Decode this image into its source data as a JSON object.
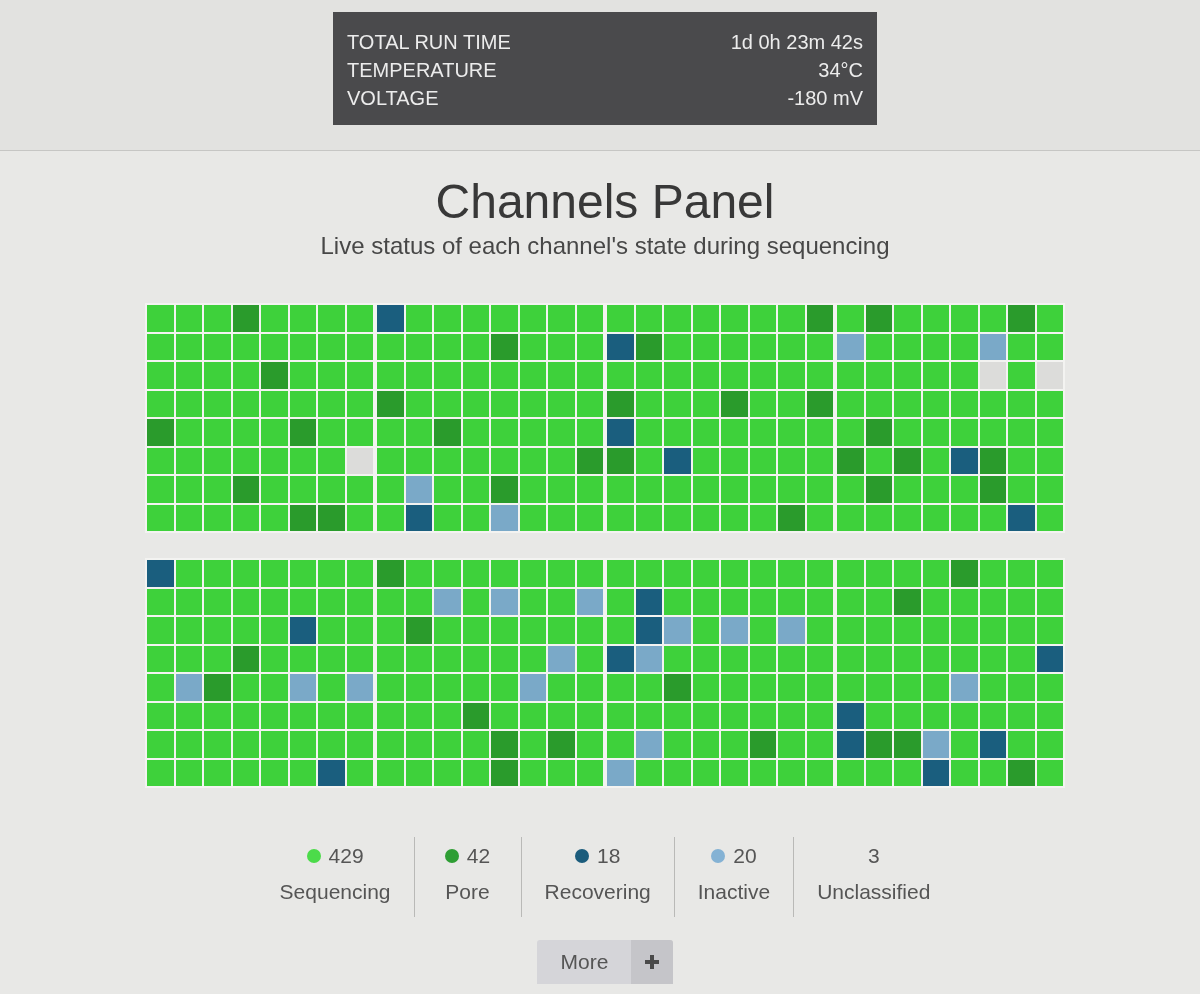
{
  "status_panel": {
    "rows": [
      {
        "label": "TOTAL RUN TIME",
        "value": "1d 0h 23m 42s"
      },
      {
        "label": "TEMPERATURE",
        "value": "34°C"
      },
      {
        "label": "VOLTAGE",
        "value": "-180 mV"
      }
    ]
  },
  "title": "Channels Panel",
  "subtitle": "Live status of each channel's state during sequencing",
  "blocks": [
    {
      "rows": [
        {
          "cells": [
            {
              "color": "#3ed13b"
            },
            {
              "color": "#3ed13b"
            },
            {
              "color": "#3ed13b"
            },
            {
              "color": "#2a9b2c"
            },
            {
              "color": "#3ed13b"
            },
            {
              "color": "#3ed13b"
            },
            {
              "color": "#3ed13b"
            },
            {
              "color": "#3ed13b"
            },
            {
              "color": "#1a5e7e"
            },
            {
              "color": "#3ed13b"
            },
            {
              "color": "#3ed13b"
            },
            {
              "color": "#3ed13b"
            },
            {
              "color": "#3ed13b"
            },
            {
              "color": "#3ed13b"
            },
            {
              "color": "#3ed13b"
            },
            {
              "color": "#3ed13b"
            },
            {
              "color": "#3ed13b"
            },
            {
              "color": "#3ed13b"
            },
            {
              "color": "#3ed13b"
            },
            {
              "color": "#3ed13b"
            },
            {
              "color": "#3ed13b"
            },
            {
              "color": "#3ed13b"
            },
            {
              "color": "#3ed13b"
            },
            {
              "color": "#2a9b2c"
            },
            {
              "color": "#3ed13b"
            },
            {
              "color": "#2a9b2c"
            },
            {
              "color": "#3ed13b"
            },
            {
              "color": "#3ed13b"
            },
            {
              "color": "#3ed13b"
            },
            {
              "color": "#3ed13b"
            },
            {
              "color": "#2a9b2c"
            },
            {
              "color": "#3ed13b"
            }
          ]
        },
        {
          "cells": [
            {
              "color": "#3ed13b"
            },
            {
              "color": "#3ed13b"
            },
            {
              "color": "#3ed13b"
            },
            {
              "color": "#3ed13b"
            },
            {
              "color": "#3ed13b"
            },
            {
              "color": "#3ed13b"
            },
            {
              "color": "#3ed13b"
            },
            {
              "color": "#3ed13b"
            },
            {
              "color": "#3ed13b"
            },
            {
              "color": "#3ed13b"
            },
            {
              "color": "#3ed13b"
            },
            {
              "color": "#3ed13b"
            },
            {
              "color": "#2a9b2c"
            },
            {
              "color": "#3ed13b"
            },
            {
              "color": "#3ed13b"
            },
            {
              "color": "#3ed13b"
            },
            {
              "color": "#1a5e7e"
            },
            {
              "color": "#2a9b2c"
            },
            {
              "color": "#3ed13b"
            },
            {
              "color": "#3ed13b"
            },
            {
              "color": "#3ed13b"
            },
            {
              "color": "#3ed13b"
            },
            {
              "color": "#3ed13b"
            },
            {
              "color": "#3ed13b"
            },
            {
              "color": "#7aa9c8"
            },
            {
              "color": "#3ed13b"
            },
            {
              "color": "#3ed13b"
            },
            {
              "color": "#3ed13b"
            },
            {
              "color": "#3ed13b"
            },
            {
              "color": "#7aa9c8"
            },
            {
              "color": "#3ed13b"
            },
            {
              "color": "#3ed13b"
            }
          ]
        },
        {
          "cells": [
            {
              "color": "#3ed13b"
            },
            {
              "color": "#3ed13b"
            },
            {
              "color": "#3ed13b"
            },
            {
              "color": "#3ed13b"
            },
            {
              "color": "#2a9b2c"
            },
            {
              "color": "#3ed13b"
            },
            {
              "color": "#3ed13b"
            },
            {
              "color": "#3ed13b"
            },
            {
              "color": "#3ed13b"
            },
            {
              "color": "#3ed13b"
            },
            {
              "color": "#3ed13b"
            },
            {
              "color": "#3ed13b"
            },
            {
              "color": "#3ed13b"
            },
            {
              "color": "#3ed13b"
            },
            {
              "color": "#3ed13b"
            },
            {
              "color": "#3ed13b"
            },
            {
              "color": "#3ed13b"
            },
            {
              "color": "#3ed13b"
            },
            {
              "color": "#3ed13b"
            },
            {
              "color": "#3ed13b"
            },
            {
              "color": "#3ed13b"
            },
            {
              "color": "#3ed13b"
            },
            {
              "color": "#3ed13b"
            },
            {
              "color": "#3ed13b"
            },
            {
              "color": "#3ed13b"
            },
            {
              "color": "#3ed13b"
            },
            {
              "color": "#3ed13b"
            },
            {
              "color": "#3ed13b"
            },
            {
              "color": "#3ed13b"
            },
            {
              "color": "#dcdcda"
            },
            {
              "color": "#3ed13b"
            },
            {
              "color": "#dcdcda"
            }
          ]
        },
        {
          "cells": [
            {
              "color": "#3ed13b"
            },
            {
              "color": "#3ed13b"
            },
            {
              "color": "#3ed13b"
            },
            {
              "color": "#3ed13b"
            },
            {
              "color": "#3ed13b"
            },
            {
              "color": "#3ed13b"
            },
            {
              "color": "#3ed13b"
            },
            {
              "color": "#3ed13b"
            },
            {
              "color": "#2a9b2c"
            },
            {
              "color": "#3ed13b"
            },
            {
              "color": "#3ed13b"
            },
            {
              "color": "#3ed13b"
            },
            {
              "color": "#3ed13b"
            },
            {
              "color": "#3ed13b"
            },
            {
              "color": "#3ed13b"
            },
            {
              "color": "#3ed13b"
            },
            {
              "color": "#2a9b2c"
            },
            {
              "color": "#3ed13b"
            },
            {
              "color": "#3ed13b"
            },
            {
              "color": "#3ed13b"
            },
            {
              "color": "#2a9b2c"
            },
            {
              "color": "#3ed13b"
            },
            {
              "color": "#3ed13b"
            },
            {
              "color": "#2a9b2c"
            },
            {
              "color": "#3ed13b"
            },
            {
              "color": "#3ed13b"
            },
            {
              "color": "#3ed13b"
            },
            {
              "color": "#3ed13b"
            },
            {
              "color": "#3ed13b"
            },
            {
              "color": "#3ed13b"
            },
            {
              "color": "#3ed13b"
            },
            {
              "color": "#3ed13b"
            }
          ]
        },
        {
          "cells": [
            {
              "color": "#2a9b2c"
            },
            {
              "color": "#3ed13b"
            },
            {
              "color": "#3ed13b"
            },
            {
              "color": "#3ed13b"
            },
            {
              "color": "#3ed13b"
            },
            {
              "color": "#2a9b2c"
            },
            {
              "color": "#3ed13b"
            },
            {
              "color": "#3ed13b"
            },
            {
              "color": "#3ed13b"
            },
            {
              "color": "#3ed13b"
            },
            {
              "color": "#2a9b2c"
            },
            {
              "color": "#3ed13b"
            },
            {
              "color": "#3ed13b"
            },
            {
              "color": "#3ed13b"
            },
            {
              "color": "#3ed13b"
            },
            {
              "color": "#3ed13b"
            },
            {
              "color": "#1a5e7e"
            },
            {
              "color": "#3ed13b"
            },
            {
              "color": "#3ed13b"
            },
            {
              "color": "#3ed13b"
            },
            {
              "color": "#3ed13b"
            },
            {
              "color": "#3ed13b"
            },
            {
              "color": "#3ed13b"
            },
            {
              "color": "#3ed13b"
            },
            {
              "color": "#3ed13b"
            },
            {
              "color": "#2a9b2c"
            },
            {
              "color": "#3ed13b"
            },
            {
              "color": "#3ed13b"
            },
            {
              "color": "#3ed13b"
            },
            {
              "color": "#3ed13b"
            },
            {
              "color": "#3ed13b"
            },
            {
              "color": "#3ed13b"
            }
          ]
        },
        {
          "cells": [
            {
              "color": "#3ed13b"
            },
            {
              "color": "#3ed13b"
            },
            {
              "color": "#3ed13b"
            },
            {
              "color": "#3ed13b"
            },
            {
              "color": "#3ed13b"
            },
            {
              "color": "#3ed13b"
            },
            {
              "color": "#3ed13b"
            },
            {
              "color": "#dcdcda"
            },
            {
              "color": "#3ed13b"
            },
            {
              "color": "#3ed13b"
            },
            {
              "color": "#3ed13b"
            },
            {
              "color": "#3ed13b"
            },
            {
              "color": "#3ed13b"
            },
            {
              "color": "#3ed13b"
            },
            {
              "color": "#3ed13b"
            },
            {
              "color": "#2a9b2c"
            },
            {
              "color": "#2a9b2c"
            },
            {
              "color": "#3ed13b"
            },
            {
              "color": "#1a5e7e"
            },
            {
              "color": "#3ed13b"
            },
            {
              "color": "#3ed13b"
            },
            {
              "color": "#3ed13b"
            },
            {
              "color": "#3ed13b"
            },
            {
              "color": "#3ed13b"
            },
            {
              "color": "#2a9b2c"
            },
            {
              "color": "#3ed13b"
            },
            {
              "color": "#2a9b2c"
            },
            {
              "color": "#3ed13b"
            },
            {
              "color": "#1a5e7e"
            },
            {
              "color": "#2a9b2c"
            },
            {
              "color": "#3ed13b"
            },
            {
              "color": "#3ed13b"
            }
          ]
        },
        {
          "cells": [
            {
              "color": "#3ed13b"
            },
            {
              "color": "#3ed13b"
            },
            {
              "color": "#3ed13b"
            },
            {
              "color": "#2a9b2c"
            },
            {
              "color": "#3ed13b"
            },
            {
              "color": "#3ed13b"
            },
            {
              "color": "#3ed13b"
            },
            {
              "color": "#3ed13b"
            },
            {
              "color": "#3ed13b"
            },
            {
              "color": "#7aa9c8"
            },
            {
              "color": "#3ed13b"
            },
            {
              "color": "#3ed13b"
            },
            {
              "color": "#2a9b2c"
            },
            {
              "color": "#3ed13b"
            },
            {
              "color": "#3ed13b"
            },
            {
              "color": "#3ed13b"
            },
            {
              "color": "#3ed13b"
            },
            {
              "color": "#3ed13b"
            },
            {
              "color": "#3ed13b"
            },
            {
              "color": "#3ed13b"
            },
            {
              "color": "#3ed13b"
            },
            {
              "color": "#3ed13b"
            },
            {
              "color": "#3ed13b"
            },
            {
              "color": "#3ed13b"
            },
            {
              "color": "#3ed13b"
            },
            {
              "color": "#2a9b2c"
            },
            {
              "color": "#3ed13b"
            },
            {
              "color": "#3ed13b"
            },
            {
              "color": "#3ed13b"
            },
            {
              "color": "#2a9b2c"
            },
            {
              "color": "#3ed13b"
            },
            {
              "color": "#3ed13b"
            }
          ]
        },
        {
          "cells": [
            {
              "color": "#3ed13b"
            },
            {
              "color": "#3ed13b"
            },
            {
              "color": "#3ed13b"
            },
            {
              "color": "#3ed13b"
            },
            {
              "color": "#3ed13b"
            },
            {
              "color": "#2a9b2c"
            },
            {
              "color": "#2a9b2c"
            },
            {
              "color": "#3ed13b"
            },
            {
              "color": "#3ed13b"
            },
            {
              "color": "#1a5e7e"
            },
            {
              "color": "#3ed13b"
            },
            {
              "color": "#3ed13b"
            },
            {
              "color": "#7aa9c8"
            },
            {
              "color": "#3ed13b"
            },
            {
              "color": "#3ed13b"
            },
            {
              "color": "#3ed13b"
            },
            {
              "color": "#3ed13b"
            },
            {
              "color": "#3ed13b"
            },
            {
              "color": "#3ed13b"
            },
            {
              "color": "#3ed13b"
            },
            {
              "color": "#3ed13b"
            },
            {
              "color": "#3ed13b"
            },
            {
              "color": "#2a9b2c"
            },
            {
              "color": "#3ed13b"
            },
            {
              "color": "#3ed13b"
            },
            {
              "color": "#3ed13b"
            },
            {
              "color": "#3ed13b"
            },
            {
              "color": "#3ed13b"
            },
            {
              "color": "#3ed13b"
            },
            {
              "color": "#3ed13b"
            },
            {
              "color": "#1a5e7e"
            },
            {
              "color": "#3ed13b"
            }
          ]
        }
      ]
    },
    {
      "rows": [
        {
          "cells": [
            {
              "color": "#1a5e7e"
            },
            {
              "color": "#3ed13b"
            },
            {
              "color": "#3ed13b"
            },
            {
              "color": "#3ed13b"
            },
            {
              "color": "#3ed13b"
            },
            {
              "color": "#3ed13b"
            },
            {
              "color": "#3ed13b"
            },
            {
              "color": "#3ed13b"
            },
            {
              "color": "#2a9b2c"
            },
            {
              "color": "#3ed13b"
            },
            {
              "color": "#3ed13b"
            },
            {
              "color": "#3ed13b"
            },
            {
              "color": "#3ed13b"
            },
            {
              "color": "#3ed13b"
            },
            {
              "color": "#3ed13b"
            },
            {
              "color": "#3ed13b"
            },
            {
              "color": "#3ed13b"
            },
            {
              "color": "#3ed13b"
            },
            {
              "color": "#3ed13b"
            },
            {
              "color": "#3ed13b"
            },
            {
              "color": "#3ed13b"
            },
            {
              "color": "#3ed13b"
            },
            {
              "color": "#3ed13b"
            },
            {
              "color": "#3ed13b"
            },
            {
              "color": "#3ed13b"
            },
            {
              "color": "#3ed13b"
            },
            {
              "color": "#3ed13b"
            },
            {
              "color": "#3ed13b"
            },
            {
              "color": "#2a9b2c"
            },
            {
              "color": "#3ed13b"
            },
            {
              "color": "#3ed13b"
            },
            {
              "color": "#3ed13b"
            }
          ]
        },
        {
          "cells": [
            {
              "color": "#3ed13b"
            },
            {
              "color": "#3ed13b"
            },
            {
              "color": "#3ed13b"
            },
            {
              "color": "#3ed13b"
            },
            {
              "color": "#3ed13b"
            },
            {
              "color": "#3ed13b"
            },
            {
              "color": "#3ed13b"
            },
            {
              "color": "#3ed13b"
            },
            {
              "color": "#3ed13b"
            },
            {
              "color": "#3ed13b"
            },
            {
              "color": "#7aa9c8"
            },
            {
              "color": "#3ed13b"
            },
            {
              "color": "#7aa9c8"
            },
            {
              "color": "#3ed13b"
            },
            {
              "color": "#3ed13b"
            },
            {
              "color": "#7aa9c8"
            },
            {
              "color": "#3ed13b"
            },
            {
              "color": "#1a5e7e"
            },
            {
              "color": "#3ed13b"
            },
            {
              "color": "#3ed13b"
            },
            {
              "color": "#3ed13b"
            },
            {
              "color": "#3ed13b"
            },
            {
              "color": "#3ed13b"
            },
            {
              "color": "#3ed13b"
            },
            {
              "color": "#3ed13b"
            },
            {
              "color": "#3ed13b"
            },
            {
              "color": "#2a9b2c"
            },
            {
              "color": "#3ed13b"
            },
            {
              "color": "#3ed13b"
            },
            {
              "color": "#3ed13b"
            },
            {
              "color": "#3ed13b"
            },
            {
              "color": "#3ed13b"
            }
          ]
        },
        {
          "cells": [
            {
              "color": "#3ed13b"
            },
            {
              "color": "#3ed13b"
            },
            {
              "color": "#3ed13b"
            },
            {
              "color": "#3ed13b"
            },
            {
              "color": "#3ed13b"
            },
            {
              "color": "#1a5e7e"
            },
            {
              "color": "#3ed13b"
            },
            {
              "color": "#3ed13b"
            },
            {
              "color": "#3ed13b"
            },
            {
              "color": "#2a9b2c"
            },
            {
              "color": "#3ed13b"
            },
            {
              "color": "#3ed13b"
            },
            {
              "color": "#3ed13b"
            },
            {
              "color": "#3ed13b"
            },
            {
              "color": "#3ed13b"
            },
            {
              "color": "#3ed13b"
            },
            {
              "color": "#3ed13b"
            },
            {
              "color": "#1a5e7e"
            },
            {
              "color": "#7aa9c8"
            },
            {
              "color": "#3ed13b"
            },
            {
              "color": "#7aa9c8"
            },
            {
              "color": "#3ed13b"
            },
            {
              "color": "#7aa9c8"
            },
            {
              "color": "#3ed13b"
            },
            {
              "color": "#3ed13b"
            },
            {
              "color": "#3ed13b"
            },
            {
              "color": "#3ed13b"
            },
            {
              "color": "#3ed13b"
            },
            {
              "color": "#3ed13b"
            },
            {
              "color": "#3ed13b"
            },
            {
              "color": "#3ed13b"
            },
            {
              "color": "#3ed13b"
            }
          ]
        },
        {
          "cells": [
            {
              "color": "#3ed13b"
            },
            {
              "color": "#3ed13b"
            },
            {
              "color": "#3ed13b"
            },
            {
              "color": "#2a9b2c"
            },
            {
              "color": "#3ed13b"
            },
            {
              "color": "#3ed13b"
            },
            {
              "color": "#3ed13b"
            },
            {
              "color": "#3ed13b"
            },
            {
              "color": "#3ed13b"
            },
            {
              "color": "#3ed13b"
            },
            {
              "color": "#3ed13b"
            },
            {
              "color": "#3ed13b"
            },
            {
              "color": "#3ed13b"
            },
            {
              "color": "#3ed13b"
            },
            {
              "color": "#7aa9c8"
            },
            {
              "color": "#3ed13b"
            },
            {
              "color": "#1a5e7e"
            },
            {
              "color": "#7aa9c8"
            },
            {
              "color": "#3ed13b"
            },
            {
              "color": "#3ed13b"
            },
            {
              "color": "#3ed13b"
            },
            {
              "color": "#3ed13b"
            },
            {
              "color": "#3ed13b"
            },
            {
              "color": "#3ed13b"
            },
            {
              "color": "#3ed13b"
            },
            {
              "color": "#3ed13b"
            },
            {
              "color": "#3ed13b"
            },
            {
              "color": "#3ed13b"
            },
            {
              "color": "#3ed13b"
            },
            {
              "color": "#3ed13b"
            },
            {
              "color": "#3ed13b"
            },
            {
              "color": "#1a5e7e"
            }
          ]
        },
        {
          "cells": [
            {
              "color": "#3ed13b"
            },
            {
              "color": "#7aa9c8"
            },
            {
              "color": "#2a9b2c"
            },
            {
              "color": "#3ed13b"
            },
            {
              "color": "#3ed13b"
            },
            {
              "color": "#7aa9c8"
            },
            {
              "color": "#3ed13b"
            },
            {
              "color": "#7aa9c8"
            },
            {
              "color": "#3ed13b"
            },
            {
              "color": "#3ed13b"
            },
            {
              "color": "#3ed13b"
            },
            {
              "color": "#3ed13b"
            },
            {
              "color": "#3ed13b"
            },
            {
              "color": "#7aa9c8"
            },
            {
              "color": "#3ed13b"
            },
            {
              "color": "#3ed13b"
            },
            {
              "color": "#3ed13b"
            },
            {
              "color": "#3ed13b"
            },
            {
              "color": "#2a9b2c"
            },
            {
              "color": "#3ed13b"
            },
            {
              "color": "#3ed13b"
            },
            {
              "color": "#3ed13b"
            },
            {
              "color": "#3ed13b"
            },
            {
              "color": "#3ed13b"
            },
            {
              "color": "#3ed13b"
            },
            {
              "color": "#3ed13b"
            },
            {
              "color": "#3ed13b"
            },
            {
              "color": "#3ed13b"
            },
            {
              "color": "#7aa9c8"
            },
            {
              "color": "#3ed13b"
            },
            {
              "color": "#3ed13b"
            },
            {
              "color": "#3ed13b"
            }
          ]
        },
        {
          "cells": [
            {
              "color": "#3ed13b"
            },
            {
              "color": "#3ed13b"
            },
            {
              "color": "#3ed13b"
            },
            {
              "color": "#3ed13b"
            },
            {
              "color": "#3ed13b"
            },
            {
              "color": "#3ed13b"
            },
            {
              "color": "#3ed13b"
            },
            {
              "color": "#3ed13b"
            },
            {
              "color": "#3ed13b"
            },
            {
              "color": "#3ed13b"
            },
            {
              "color": "#3ed13b"
            },
            {
              "color": "#2a9b2c"
            },
            {
              "color": "#3ed13b"
            },
            {
              "color": "#3ed13b"
            },
            {
              "color": "#3ed13b"
            },
            {
              "color": "#3ed13b"
            },
            {
              "color": "#3ed13b"
            },
            {
              "color": "#3ed13b"
            },
            {
              "color": "#3ed13b"
            },
            {
              "color": "#3ed13b"
            },
            {
              "color": "#3ed13b"
            },
            {
              "color": "#3ed13b"
            },
            {
              "color": "#3ed13b"
            },
            {
              "color": "#3ed13b"
            },
            {
              "color": "#1a5e7e"
            },
            {
              "color": "#3ed13b"
            },
            {
              "color": "#3ed13b"
            },
            {
              "color": "#3ed13b"
            },
            {
              "color": "#3ed13b"
            },
            {
              "color": "#3ed13b"
            },
            {
              "color": "#3ed13b"
            },
            {
              "color": "#3ed13b"
            }
          ]
        },
        {
          "cells": [
            {
              "color": "#3ed13b"
            },
            {
              "color": "#3ed13b"
            },
            {
              "color": "#3ed13b"
            },
            {
              "color": "#3ed13b"
            },
            {
              "color": "#3ed13b"
            },
            {
              "color": "#3ed13b"
            },
            {
              "color": "#3ed13b"
            },
            {
              "color": "#3ed13b"
            },
            {
              "color": "#3ed13b"
            },
            {
              "color": "#3ed13b"
            },
            {
              "color": "#3ed13b"
            },
            {
              "color": "#3ed13b"
            },
            {
              "color": "#2a9b2c"
            },
            {
              "color": "#3ed13b"
            },
            {
              "color": "#2a9b2c"
            },
            {
              "color": "#3ed13b"
            },
            {
              "color": "#3ed13b"
            },
            {
              "color": "#7aa9c8"
            },
            {
              "color": "#3ed13b"
            },
            {
              "color": "#3ed13b"
            },
            {
              "color": "#3ed13b"
            },
            {
              "color": "#2a9b2c"
            },
            {
              "color": "#3ed13b"
            },
            {
              "color": "#3ed13b"
            },
            {
              "color": "#1a5e7e"
            },
            {
              "color": "#2a9b2c"
            },
            {
              "color": "#2a9b2c"
            },
            {
              "color": "#7aa9c8"
            },
            {
              "color": "#3ed13b"
            },
            {
              "color": "#1a5e7e"
            },
            {
              "color": "#3ed13b"
            },
            {
              "color": "#3ed13b"
            }
          ]
        },
        {
          "cells": [
            {
              "color": "#3ed13b"
            },
            {
              "color": "#3ed13b"
            },
            {
              "color": "#3ed13b"
            },
            {
              "color": "#3ed13b"
            },
            {
              "color": "#3ed13b"
            },
            {
              "color": "#3ed13b"
            },
            {
              "color": "#1a5e7e"
            },
            {
              "color": "#3ed13b"
            },
            {
              "color": "#3ed13b"
            },
            {
              "color": "#3ed13b"
            },
            {
              "color": "#3ed13b"
            },
            {
              "color": "#3ed13b"
            },
            {
              "color": "#2a9b2c"
            },
            {
              "color": "#3ed13b"
            },
            {
              "color": "#3ed13b"
            },
            {
              "color": "#3ed13b"
            },
            {
              "color": "#7aa9c8"
            },
            {
              "color": "#3ed13b"
            },
            {
              "color": "#3ed13b"
            },
            {
              "color": "#3ed13b"
            },
            {
              "color": "#3ed13b"
            },
            {
              "color": "#3ed13b"
            },
            {
              "color": "#3ed13b"
            },
            {
              "color": "#3ed13b"
            },
            {
              "color": "#3ed13b"
            },
            {
              "color": "#3ed13b"
            },
            {
              "color": "#3ed13b"
            },
            {
              "color": "#1a5e7e"
            },
            {
              "color": "#3ed13b"
            },
            {
              "color": "#3ed13b"
            },
            {
              "color": "#2a9b2c"
            },
            {
              "color": "#3ed13b"
            }
          ]
        }
      ]
    }
  ],
  "legend": [
    {
      "count": "429",
      "label": "Sequencing",
      "color": "#4cdb4a"
    },
    {
      "count": "42",
      "label": "Pore",
      "color": "#2e9e34"
    },
    {
      "count": "18",
      "label": "Recovering",
      "color": "#1b5c7c"
    },
    {
      "count": "20",
      "label": "Inactive",
      "color": "#84b2d4"
    },
    {
      "count": "3",
      "label": "Unclassified"
    }
  ],
  "more_button": {
    "label": "More"
  }
}
